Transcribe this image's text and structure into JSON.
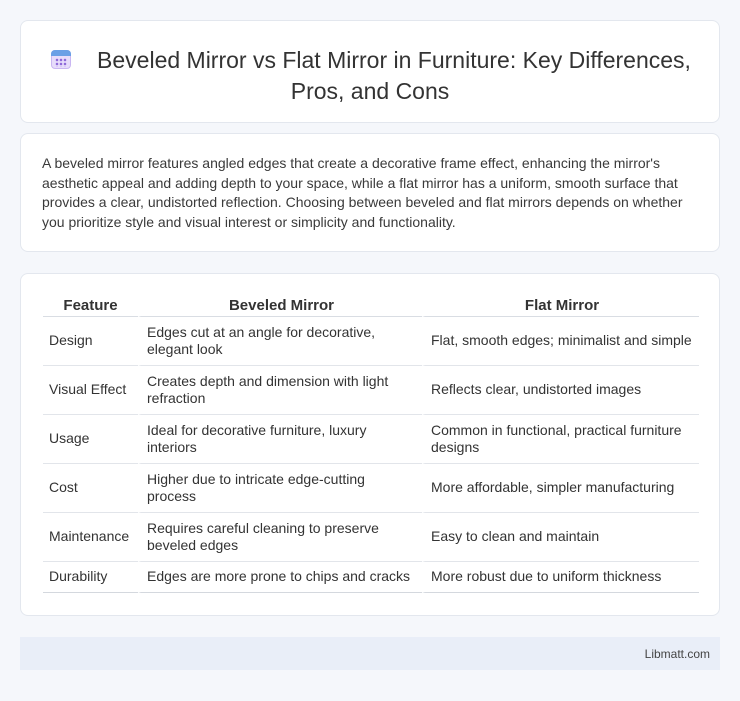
{
  "header": {
    "title": "Beveled Mirror vs Flat Mirror in Furniture: Key Differences, Pros, and Cons",
    "icon": "calendar-icon"
  },
  "intro": {
    "text": "A beveled mirror features angled edges that create a decorative frame effect, enhancing the mirror's aesthetic appeal and adding depth to your space, while a flat mirror has a uniform, smooth surface that provides a clear, undistorted reflection. Choosing between beveled and flat mirrors depends on whether you prioritize style and visual interest or simplicity and functionality."
  },
  "table": {
    "headers": [
      "Feature",
      "Beveled Mirror",
      "Flat Mirror"
    ],
    "rows": [
      [
        "Design",
        "Edges cut at an angle for decorative, elegant look",
        "Flat, smooth edges; minimalist and simple"
      ],
      [
        "Visual Effect",
        "Creates depth and dimension with light refraction",
        "Reflects clear, undistorted images"
      ],
      [
        "Usage",
        "Ideal for decorative furniture, luxury interiors",
        "Common in functional, practical furniture designs"
      ],
      [
        "Cost",
        "Higher due to intricate edge-cutting process",
        "More affordable, simpler manufacturing"
      ],
      [
        "Maintenance",
        "Requires careful cleaning to preserve beveled edges",
        "Easy to clean and maintain"
      ],
      [
        "Durability",
        "Edges are more prone to chips and cracks",
        "More robust due to uniform thickness"
      ]
    ]
  },
  "footer": {
    "brand": "Libmatt.com"
  }
}
